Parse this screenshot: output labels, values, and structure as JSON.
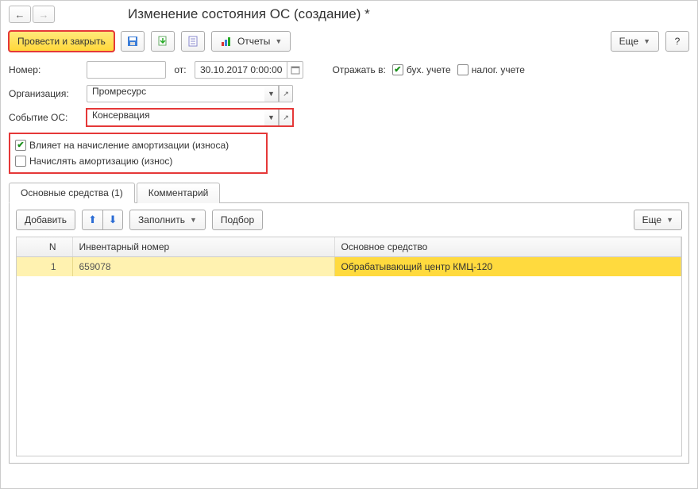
{
  "title": "Изменение состояния ОС (создание) *",
  "toolbar": {
    "post_and_close": "Провести и закрыть",
    "reports": "Отчеты",
    "more": "Еще",
    "help": "?"
  },
  "form": {
    "number_label": "Номер:",
    "number_value": "",
    "from_label": "от:",
    "date_value": "30.10.2017  0:00:00",
    "reflect_in_label": "Отражать в:",
    "book_accounting": "бух. учете",
    "tax_accounting": "налог. учете",
    "organization_label": "Организация:",
    "organization_value": "Промресурс",
    "event_label": "Событие ОС:",
    "event_value": "Консервация",
    "affects_amort": "Влияет на начисление амортизации (износа)",
    "calc_amort": "Начислять амортизацию (износ)"
  },
  "tabs": {
    "assets": "Основные средства (1)",
    "comment": "Комментарий"
  },
  "tab_toolbar": {
    "add": "Добавить",
    "fill": "Заполнить",
    "pick": "Подбор",
    "more": "Еще"
  },
  "table": {
    "col_n": "N",
    "col_inv": "Инвентарный номер",
    "col_asset": "Основное средство",
    "rows": [
      {
        "n": "1",
        "inv": "659078",
        "asset": "Обрабатывающий центр КМЦ-120"
      }
    ]
  }
}
